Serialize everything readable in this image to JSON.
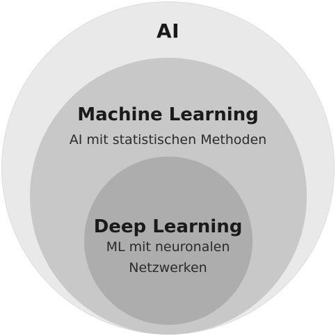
{
  "ai": {
    "title": "AI"
  },
  "machine_learning": {
    "title": "Machine Learning",
    "description": "AI mit statistischen Methoden"
  },
  "deep_learning": {
    "title": "Deep Learning",
    "description_line1": "ML mit neuronalen",
    "description_line2": "Netzwerken"
  },
  "colors": {
    "ai_circle": "#e9e9e9",
    "ml_circle": "#c8c8c8",
    "dl_circle": "#adadad",
    "text": "#1a1a1a"
  }
}
